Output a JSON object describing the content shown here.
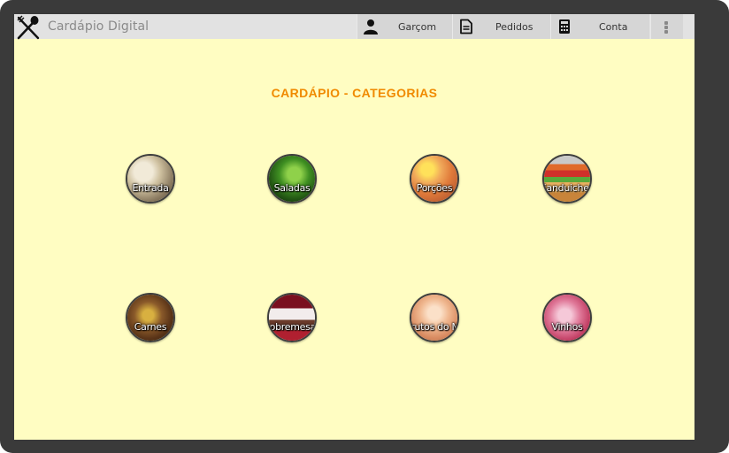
{
  "app": {
    "title": "Cardápio Digital",
    "logo_icon": "utensils-icon"
  },
  "toolbar": {
    "tabs": [
      {
        "label": "Garçom",
        "icon": "person-icon"
      },
      {
        "label": "Pedidos",
        "icon": "document-icon"
      },
      {
        "label": "Conta",
        "icon": "calculator-icon"
      }
    ],
    "overflow_icon": "more-vert-icon"
  },
  "main": {
    "heading": "CARDÁPIO - CATEGORIAS",
    "categories": [
      {
        "label": "Entrada"
      },
      {
        "label": "Saladas"
      },
      {
        "label": "Porções"
      },
      {
        "label": "Sanduiches"
      },
      {
        "label": "Carnes"
      },
      {
        "label": "Sobremesas"
      },
      {
        "label": "Frutos do Mar"
      },
      {
        "label": "Vinhos"
      }
    ]
  },
  "colors": {
    "background": "#fffdc2",
    "heading": "#f08a00",
    "appbar": "#e2e2e2",
    "tab": "#d6d6d6",
    "device_frame": "#3a3a3a"
  }
}
